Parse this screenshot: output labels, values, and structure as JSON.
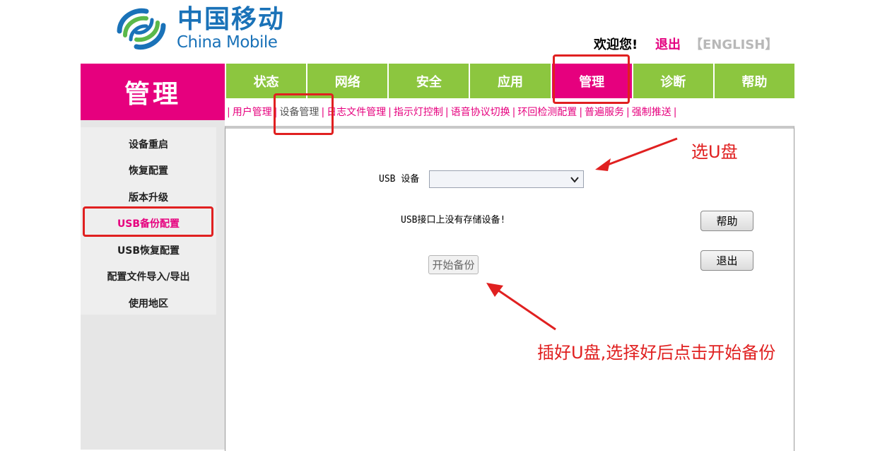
{
  "header": {
    "logo_cn": "中国移动",
    "logo_en": "China Mobile",
    "welcome": "欢迎您!",
    "logout": "退出",
    "english": "【ENGLISH】"
  },
  "section_title": "管理",
  "tabs": [
    {
      "label": "状态",
      "active": false
    },
    {
      "label": "网络",
      "active": false
    },
    {
      "label": "安全",
      "active": false
    },
    {
      "label": "应用",
      "active": false
    },
    {
      "label": "管理",
      "active": true
    },
    {
      "label": "诊断",
      "active": false
    },
    {
      "label": "帮助",
      "active": false
    }
  ],
  "subnav": [
    {
      "label": "用户管理",
      "active": false
    },
    {
      "label": "设备管理",
      "active": true
    },
    {
      "label": "日志文件管理",
      "active": false
    },
    {
      "label": "指示灯控制",
      "active": false
    },
    {
      "label": "语音协议切换",
      "active": false
    },
    {
      "label": "环回检测配置",
      "active": false
    },
    {
      "label": "普遍服务",
      "active": false
    },
    {
      "label": "强制推送",
      "active": false
    }
  ],
  "sidebar": [
    {
      "label": "设备重启",
      "active": false
    },
    {
      "label": "恢复配置",
      "active": false
    },
    {
      "label": "版本升级",
      "active": false
    },
    {
      "label": "USB备份配置",
      "active": true
    },
    {
      "label": "USB恢复配置",
      "active": false
    },
    {
      "label": "配置文件导入/导出",
      "active": false
    },
    {
      "label": "使用地区",
      "active": false
    }
  ],
  "form": {
    "usb_label": "USB 设备",
    "usb_value": "",
    "no_device_msg": "USB接口上没有存储设备!",
    "help_button": "帮助",
    "exit_button": "退出",
    "start_button": "开始备份"
  },
  "annotations": {
    "select_usb": "选U盘",
    "insert_tip": "插好U盘,选择好后点击开始备份"
  },
  "colors": {
    "brand_magenta": "#e6007e",
    "tab_green": "#8cc63f",
    "logo_blue": "#1a72b8",
    "annotation_red": "#e02020"
  }
}
